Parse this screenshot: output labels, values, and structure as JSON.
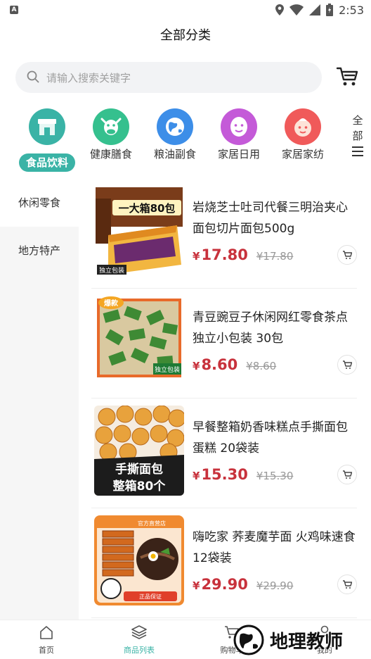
{
  "status_bar": {
    "time": "2:53"
  },
  "header": {
    "title": "全部分类"
  },
  "search": {
    "placeholder": "请输入搜索关键字"
  },
  "categories": [
    {
      "label": "食品饮料",
      "icon": "store-icon",
      "color": "#3ab3a6",
      "active": true
    },
    {
      "label": "健康膳食",
      "icon": "cow-icon",
      "color": "#35c08e",
      "active": false
    },
    {
      "label": "粮油副食",
      "icon": "globe-icon",
      "color": "#3d8ee8",
      "active": false
    },
    {
      "label": "家居日用",
      "icon": "face-icon",
      "color": "#c45ad8",
      "active": false
    },
    {
      "label": "家居家纺",
      "icon": "baby-face-icon",
      "color": "#f05a5a",
      "active": false
    }
  ],
  "all_categories": {
    "line1": "全",
    "line2": "部"
  },
  "sidebar": [
    {
      "label": "休闲零食",
      "active": true
    },
    {
      "label": "地方特产",
      "active": false
    }
  ],
  "products": [
    {
      "name": "岩烧芝士吐司代餐三明治夹心面包切片面包500g",
      "price": "17.80",
      "old_price": "¥17.80",
      "badge": "一大箱80包",
      "tag": "独立包装"
    },
    {
      "name": "青豆豌豆子休闲网红零食茶点独立小包装 30包",
      "price": "8.60",
      "old_price": "¥8.60",
      "badge": "爆款",
      "tag": "独立包装"
    },
    {
      "name": "早餐整箱奶香味糕点手撕面包蛋糕 20袋装",
      "price": "15.30",
      "old_price": "¥15.30",
      "badge": "手撕面包",
      "tag": "整箱80个"
    },
    {
      "name": "嗨吃家 荞麦魔芋面 火鸡味速食 12袋装",
      "price": "29.90",
      "old_price": "¥29.90",
      "badge": "官方直营店",
      "tag": "正品保证"
    }
  ],
  "currency": "¥",
  "tabbar": [
    {
      "label": "首页",
      "icon": "home-icon",
      "active": false
    },
    {
      "label": "商品列表",
      "icon": "layers-icon",
      "active": true
    },
    {
      "label": "购物车",
      "icon": "cart-icon",
      "active": false
    },
    {
      "label": "我的",
      "icon": "user-icon",
      "active": false
    }
  ],
  "watermark": {
    "text": "地理教师"
  },
  "colors": {
    "accent": "#3ab3a6",
    "price": "#c8323c"
  }
}
